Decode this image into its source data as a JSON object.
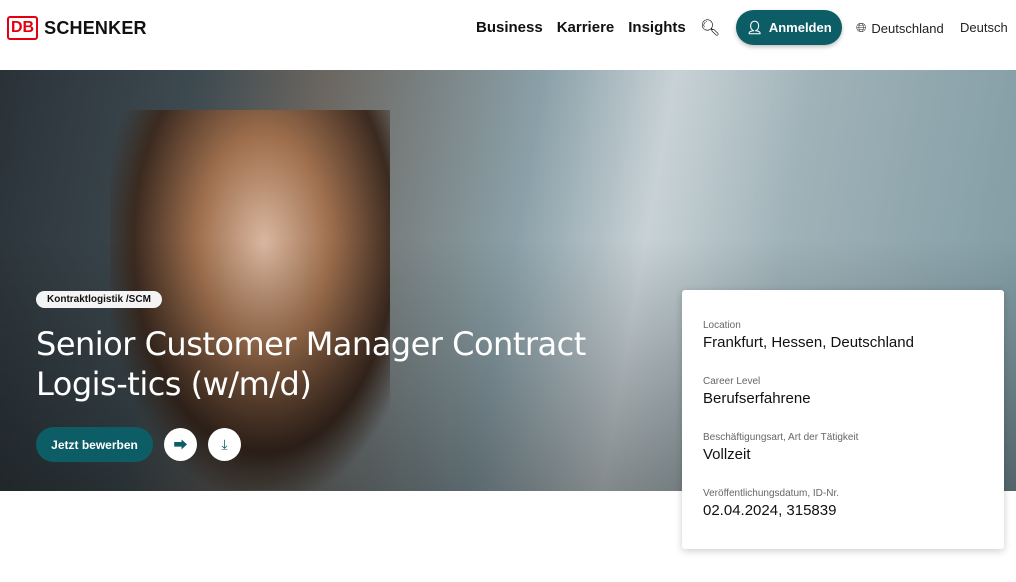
{
  "header": {
    "logo_mark": "DB",
    "brand": "SCHENKER",
    "nav": [
      "Business",
      "Karriere",
      "Insights"
    ],
    "login": "Anmelden",
    "country": "Deutschland",
    "language": "Deutsch"
  },
  "hero": {
    "tag": "Kontraktlogistik /SCM",
    "title": "Senior Customer Manager Contract Logis-tics (w/m/d)",
    "apply": "Jetzt bewerben"
  },
  "details": [
    {
      "label": "Location",
      "value": "Frankfurt, Hessen, Deutschland"
    },
    {
      "label": "Career Level",
      "value": "Berufserfahrene"
    },
    {
      "label": "Beschäftigungsart, Art der Tätigkeit",
      "value": "Vollzeit"
    },
    {
      "label": "Veröffentlichungsdatum, ID-Nr.",
      "value": "02.04.2024, 315839"
    }
  ],
  "colors": {
    "accent": "#0c5d66",
    "brand_red": "#e3000f"
  }
}
